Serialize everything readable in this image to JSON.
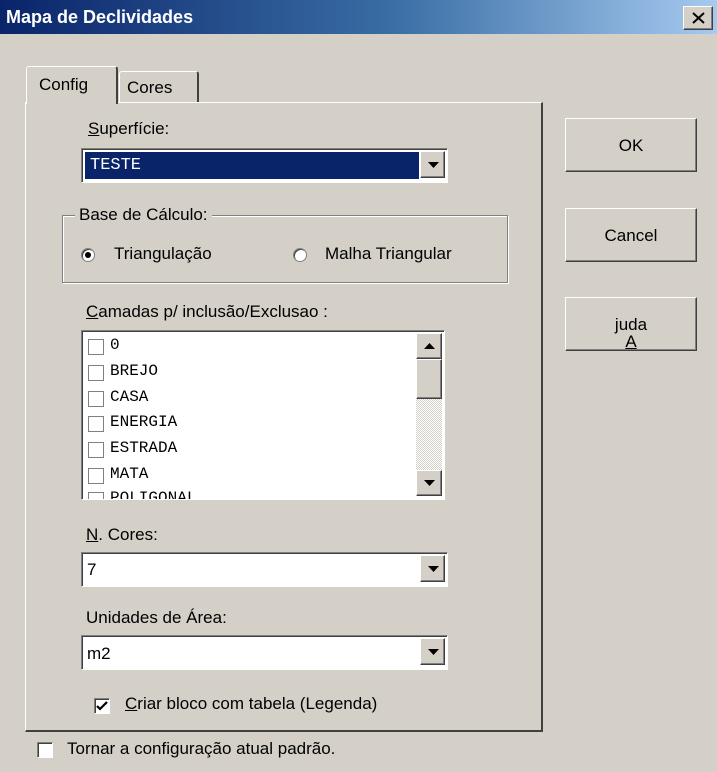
{
  "window": {
    "title": "Mapa de Declividades"
  },
  "tabs": [
    {
      "label": "Config"
    },
    {
      "label": "Cores"
    }
  ],
  "superficie": {
    "label": "Superfície:",
    "value": "TESTE"
  },
  "base": {
    "label": "Base de Cálculo:",
    "options": [
      {
        "label": "Triangulação",
        "selected": true
      },
      {
        "label": "Malha Triangular",
        "selected": false
      }
    ]
  },
  "camadas": {
    "label": "Camadas p/ inclusão/Exclusao :",
    "items": [
      "0",
      "BREJO",
      "CASA",
      "ENERGIA",
      "ESTRADA",
      "MATA",
      "POLIGONAL"
    ]
  },
  "ncores": {
    "label": "N. Cores:",
    "value": "7"
  },
  "unidades": {
    "label": "Unidades de Área:",
    "value": "m2"
  },
  "criar_bloco": {
    "label": "Criar bloco com tabela (Legenda)",
    "checked": true
  },
  "tornar_padrao": {
    "label": "Tornar a configuração atual padrão.",
    "checked": false
  },
  "buttons": {
    "ok": "OK",
    "cancel": "Cancel",
    "ajuda": "Ajuda"
  }
}
